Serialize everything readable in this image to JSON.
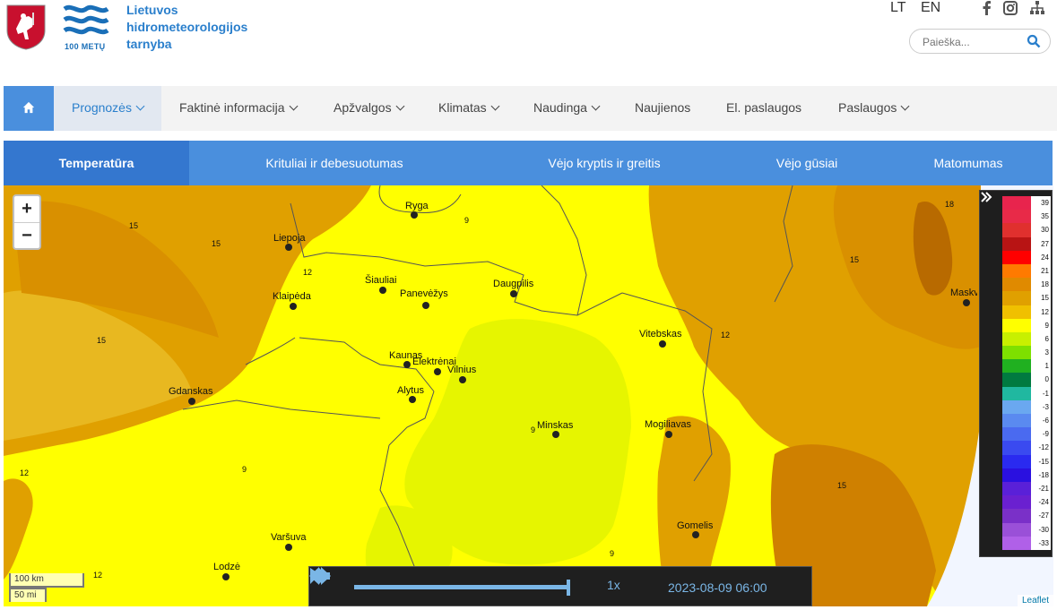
{
  "org": {
    "name_lines": [
      "Lietuvos",
      "hidrometeorologijos",
      "tarnyba"
    ],
    "logo_text": "100 METŲ"
  },
  "languages": [
    "LT",
    "EN"
  ],
  "social_icons": [
    "facebook-icon",
    "instagram-icon",
    "sitemap-icon"
  ],
  "search": {
    "placeholder": "Paieška...",
    "value": ""
  },
  "main_nav": {
    "home_icon": "home-icon",
    "items": [
      {
        "label": "Prognozės",
        "dropdown": true,
        "active": true
      },
      {
        "label": "Faktinė informacija",
        "dropdown": true
      },
      {
        "label": "Apžvalgos",
        "dropdown": true
      },
      {
        "label": "Klimatas",
        "dropdown": true
      },
      {
        "label": "Naudinga",
        "dropdown": true
      },
      {
        "label": "Naujienos",
        "dropdown": false
      },
      {
        "label": "El. paslaugos",
        "dropdown": false
      },
      {
        "label": "Paslaugos",
        "dropdown": true
      }
    ]
  },
  "sub_nav": {
    "tabs": [
      "Temperatūra",
      "Krituliai ir debesuotumas",
      "Vėjo kryptis ir greitis",
      "Vėjo gūsiai",
      "Matomumas"
    ],
    "active": "Temperatūra"
  },
  "map": {
    "zoom_in": "+",
    "zoom_out": "−",
    "scale_km": "100 km",
    "scale_mi": "50 mi",
    "attribution": "Leaflet",
    "cities": [
      "Ryga",
      "Liepoja",
      "Šiauliai",
      "Panevėžys",
      "Daugpilis",
      "Klaipėda",
      "Kaunas",
      "Elektrėnai",
      "Vilnius",
      "Alytus",
      "Vitebskas",
      "Gdanskas",
      "Minskas",
      "Mogiliavas",
      "Gomelis",
      "Varšuva",
      "Lodzė",
      "Maskva"
    ],
    "contour_labels": [
      "9",
      "12",
      "15",
      "18"
    ]
  },
  "player": {
    "speed": "1x",
    "datetime": "2023-08-09 06:00",
    "progress": 1.0
  },
  "legend": {
    "values": [
      "39",
      "35",
      "30",
      "27",
      "24",
      "21",
      "18",
      "15",
      "12",
      "9",
      "6",
      "3",
      "1",
      "0",
      "-1",
      "-3",
      "-6",
      "-9",
      "-12",
      "-15",
      "-18",
      "-21",
      "-24",
      "-27",
      "-30",
      "-33"
    ],
    "colors": [
      "#e8244d",
      "#e82a48",
      "#e0302e",
      "#b81414",
      "#ff0000",
      "#ff7a00",
      "#e08a00",
      "#e0a000",
      "#f0c000",
      "#ffff00",
      "#c8f000",
      "#7ee000",
      "#20b020",
      "#007a40",
      "#20b8a0",
      "#6aa8f0",
      "#5a8af0",
      "#4a6af0",
      "#3a4af0",
      "#2a2af0",
      "#2a10e0",
      "#5a20d8",
      "#6a20d0",
      "#7a30c8",
      "#9a50d8",
      "#b060e8"
    ]
  }
}
